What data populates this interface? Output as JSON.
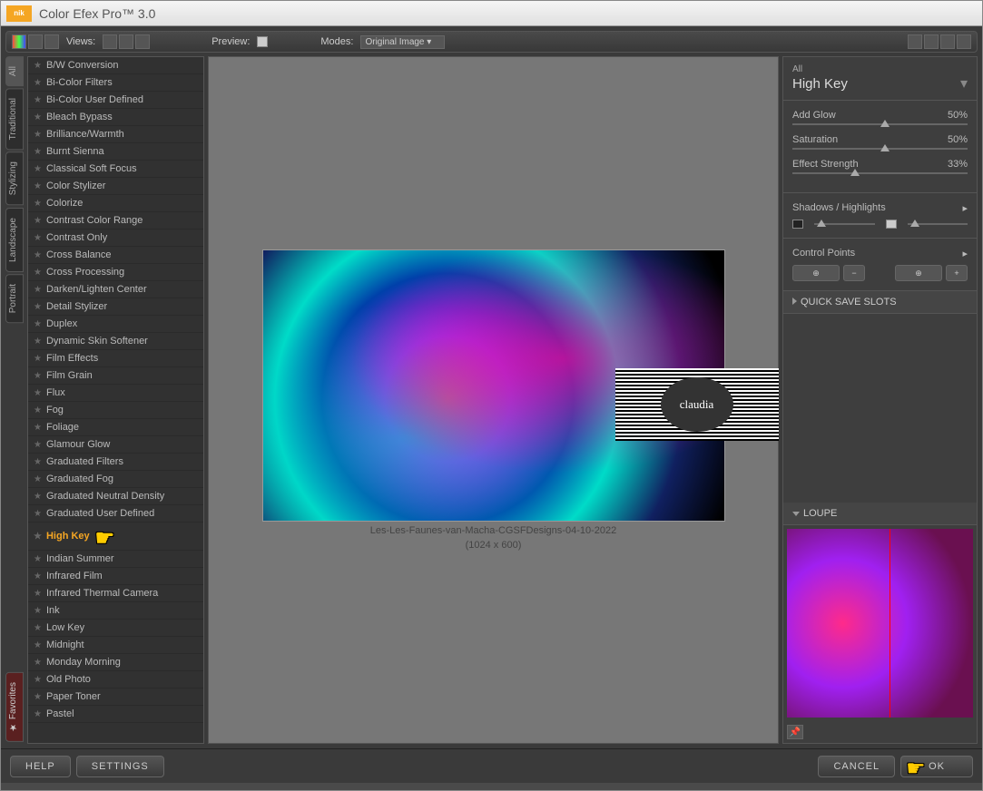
{
  "app": {
    "brand": "nik",
    "title": "Color Efex Pro™ 3.0"
  },
  "toolbar": {
    "views_label": "Views:",
    "preview_label": "Preview:",
    "modes_label": "Modes:",
    "modes_value": "Original Image"
  },
  "categories": [
    "All",
    "Traditional",
    "Stylizing",
    "Landscape",
    "Portrait"
  ],
  "favorites_tab": "Favorites",
  "filters": [
    "B/W Conversion",
    "Bi-Color Filters",
    "Bi-Color User Defined",
    "Bleach Bypass",
    "Brilliance/Warmth",
    "Burnt Sienna",
    "Classical Soft Focus",
    "Color Stylizer",
    "Colorize",
    "Contrast Color Range",
    "Contrast Only",
    "Cross Balance",
    "Cross Processing",
    "Darken/Lighten Center",
    "Detail Stylizer",
    "Duplex",
    "Dynamic Skin Softener",
    "Film Effects",
    "Film Grain",
    "Flux",
    "Fog",
    "Foliage",
    "Glamour Glow",
    "Graduated Filters",
    "Graduated Fog",
    "Graduated Neutral Density",
    "Graduated User Defined",
    "High Key",
    "Indian Summer",
    "Infrared Film",
    "Infrared Thermal Camera",
    "Ink",
    "Low Key",
    "Midnight",
    "Monday Morning",
    "Old Photo",
    "Paper Toner",
    "Pastel"
  ],
  "selected_filter": "High Key",
  "preview": {
    "caption": "Les-Les-Faunes-van-Macha-CGSFDesigns-04-10-2022",
    "dimensions": "(1024 x 600)",
    "watermark": "claudia"
  },
  "panel": {
    "category": "All",
    "filter_name": "High Key",
    "sliders": [
      {
        "label": "Add Glow",
        "value": "50%",
        "pos": 50
      },
      {
        "label": "Saturation",
        "value": "50%",
        "pos": 50
      },
      {
        "label": "Effect Strength",
        "value": "33%",
        "pos": 33
      }
    ],
    "shadows_label": "Shadows / Highlights",
    "control_points_label": "Control Points",
    "quick_save": "QUICK SAVE SLOTS",
    "loupe": "LOUPE"
  },
  "buttons": {
    "help": "HELP",
    "settings": "SETTINGS",
    "cancel": "CANCEL",
    "ok": "OK"
  }
}
